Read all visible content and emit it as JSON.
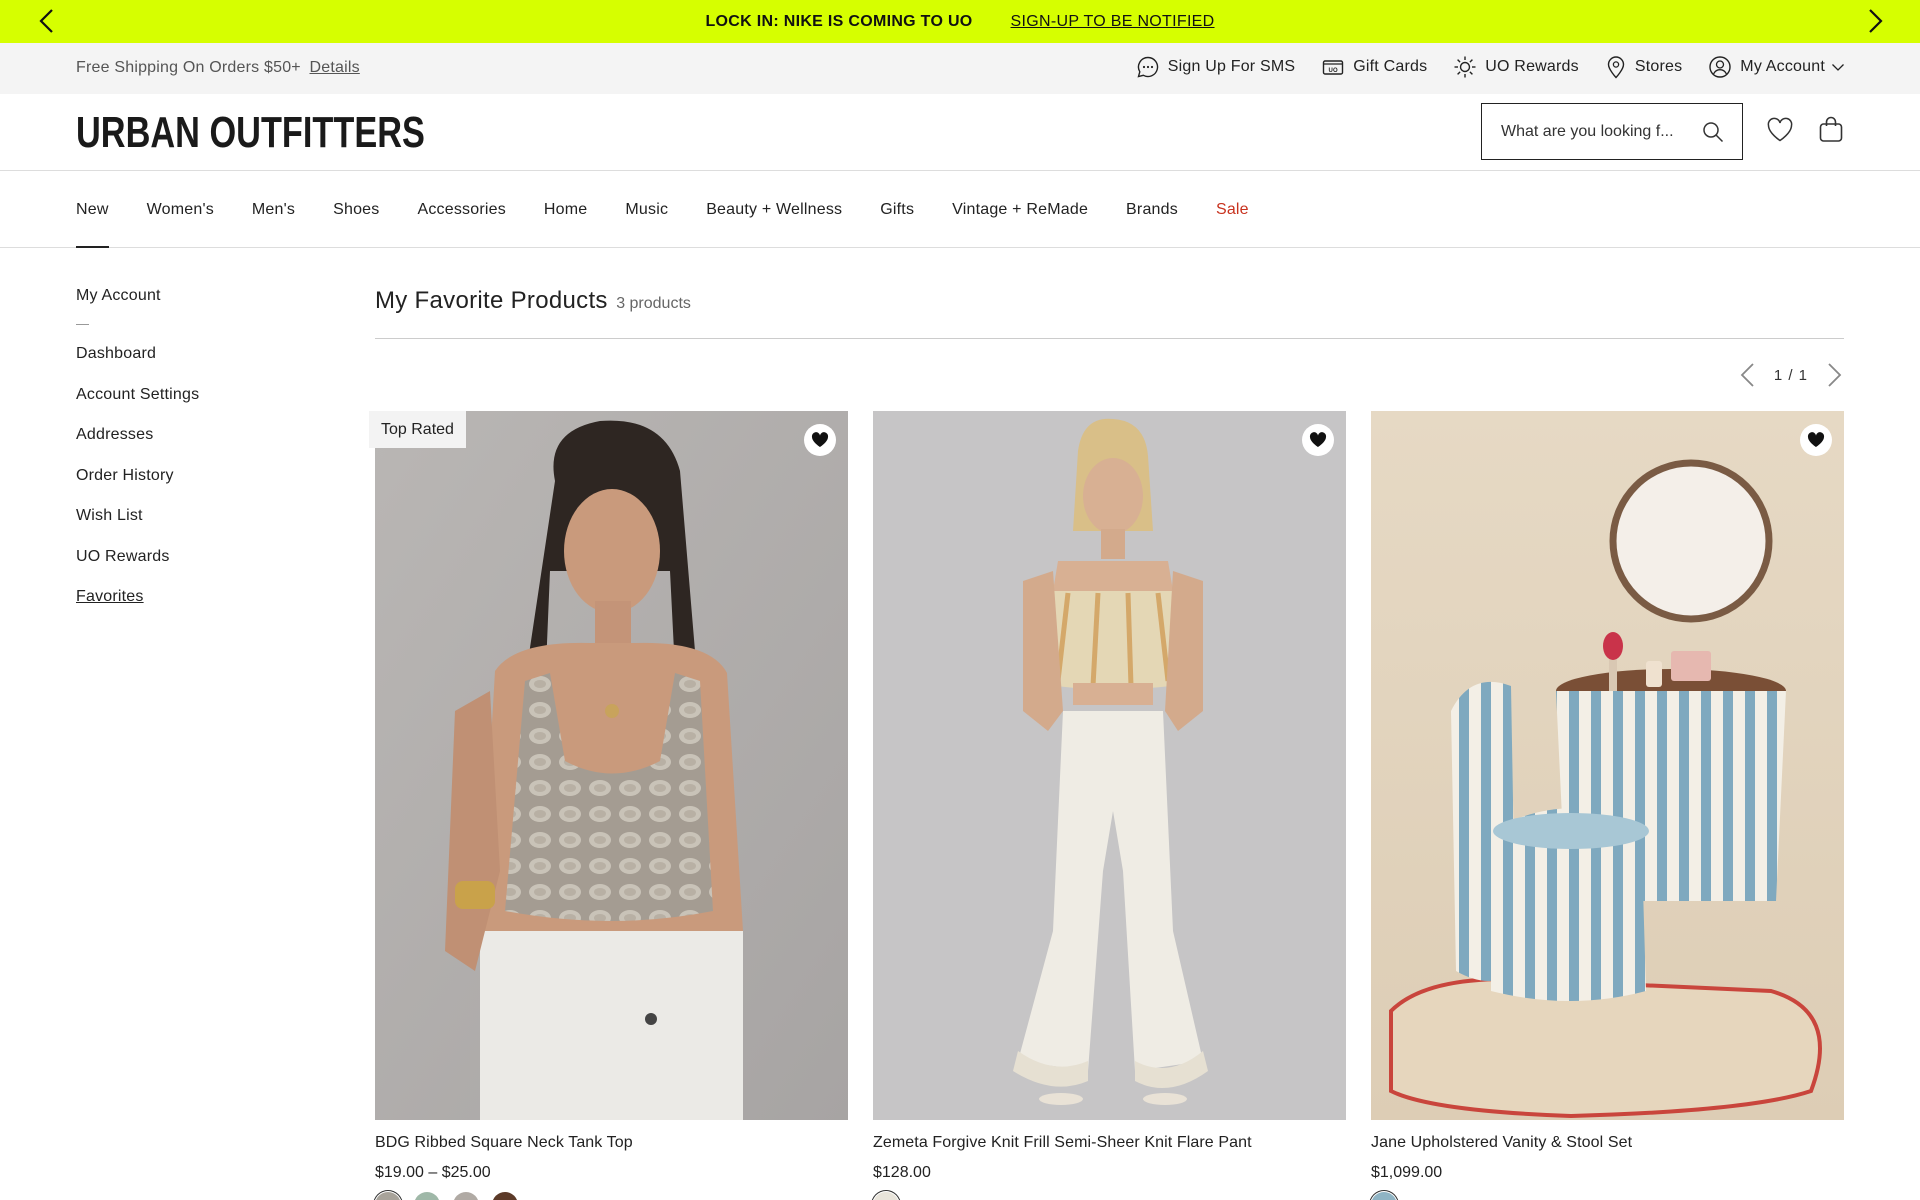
{
  "promo": {
    "text": "LOCK IN: NIKE IS COMING TO UO",
    "link": "SIGN-UP TO BE NOTIFIED",
    "bg_color": "#d6ff00"
  },
  "utility": {
    "shipping_text": "Free Shipping On Orders $50+",
    "shipping_link": "Details",
    "links": [
      {
        "label": "Sign Up For SMS",
        "icon": "chat-bubble-icon"
      },
      {
        "label": "Gift Cards",
        "icon": "gift-card-icon"
      },
      {
        "label": "UO Rewards",
        "icon": "sun-rewards-icon"
      },
      {
        "label": "Stores",
        "icon": "location-pin-icon"
      },
      {
        "label": "My Account",
        "icon": "user-circle-icon"
      }
    ]
  },
  "header": {
    "logo": "URBAN OUTFITTERS",
    "search_placeholder": "What are you looking f..."
  },
  "nav": {
    "items": [
      "New",
      "Women's",
      "Men's",
      "Shoes",
      "Accessories",
      "Home",
      "Music",
      "Beauty + Wellness",
      "Gifts",
      "Vintage + ReMade",
      "Brands",
      "Sale"
    ],
    "sale_color": "#c8321e"
  },
  "sidebar": {
    "title": "My Account",
    "items": [
      "Dashboard",
      "Account Settings",
      "Addresses",
      "Order History",
      "Wish List",
      "UO Rewards",
      "Favorites"
    ]
  },
  "main": {
    "title": "My Favorite Products",
    "count": "3 products",
    "pager": "1 / 1"
  },
  "products": [
    {
      "name": "BDG Ribbed Square Neck Tank Top",
      "price": "$19.00 – $25.00",
      "badge": "Top Rated",
      "swatches": [
        "#a8a39a",
        "#9fb8a8",
        "#b0aaa4",
        "#5c3a28"
      ]
    },
    {
      "name": "Zemeta Forgive Knit Frill Semi-Sheer Knit Flare Pant",
      "price": "$128.00",
      "badge": "",
      "swatches": [
        "#e8e4da"
      ]
    },
    {
      "name": "Jane Upholstered Vanity & Stool Set",
      "price": "$1,099.00",
      "badge": "",
      "swatches": [
        "#8fb4c4"
      ]
    }
  ]
}
